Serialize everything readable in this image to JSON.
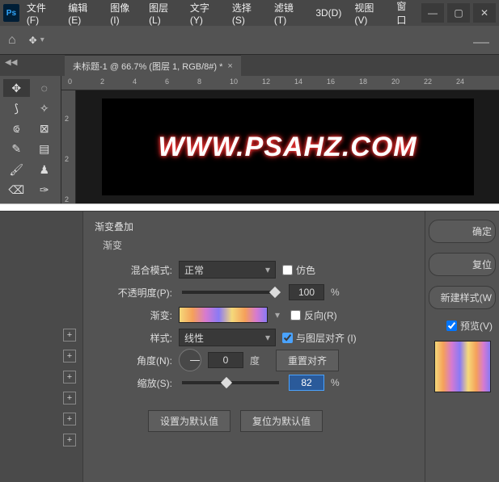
{
  "menubar": {
    "items": [
      "文件(F)",
      "编辑(E)",
      "图像(I)",
      "图层(L)",
      "文字(Y)",
      "选择(S)",
      "滤镜(T)",
      "3D(D)",
      "视图(V)",
      "窗口"
    ]
  },
  "doc_tab": {
    "title": "未标题-1 @ 66.7% (图层 1, RGB/8#) *"
  },
  "ruler_h": [
    "0",
    "2",
    "4",
    "6",
    "8",
    "10",
    "12",
    "14",
    "16",
    "18",
    "20",
    "22",
    "24"
  ],
  "ruler_v": [
    "2",
    "2",
    "2"
  ],
  "canvas_text": "WWW.PSAHZ.COM",
  "dialog": {
    "section": "渐变叠加",
    "subsection": "渐变",
    "blend_label": "混合模式:",
    "blend_value": "正常",
    "dither_label": "仿色",
    "opacity_label": "不透明度(P):",
    "opacity_value": "100",
    "pct": "%",
    "gradient_label": "渐变:",
    "reverse_label": "反向(R)",
    "style_label": "样式:",
    "style_value": "线性",
    "align_label": "与图层对齐 (I)",
    "angle_label": "角度(N):",
    "angle_value": "0",
    "angle_unit": "度",
    "reset_align": "重置对齐",
    "scale_label": "缩放(S):",
    "scale_value": "82",
    "set_default": "设置为默认值",
    "reset_default": "复位为默认值"
  },
  "right": {
    "ok": "确定",
    "cancel": "复位",
    "new_style": "新建样式(W",
    "preview": "预览(V)"
  }
}
